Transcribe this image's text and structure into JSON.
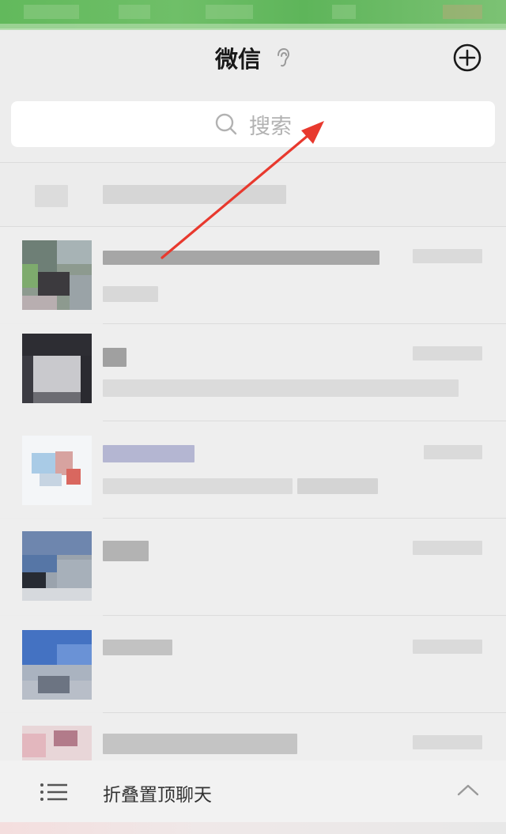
{
  "nav": {
    "title": "微信",
    "ear_icon": "ear-icon",
    "add_icon": "plus-circle-icon"
  },
  "search": {
    "placeholder": "搜索",
    "icon": "search-icon"
  },
  "fold_bar": {
    "label": "折叠置顶聊天",
    "icon": "list-icon",
    "chevron": "chevron-up-icon"
  },
  "colors": {
    "accent_green": "#62b95c",
    "background": "#ededed",
    "annotation_arrow": "#e8392e"
  }
}
